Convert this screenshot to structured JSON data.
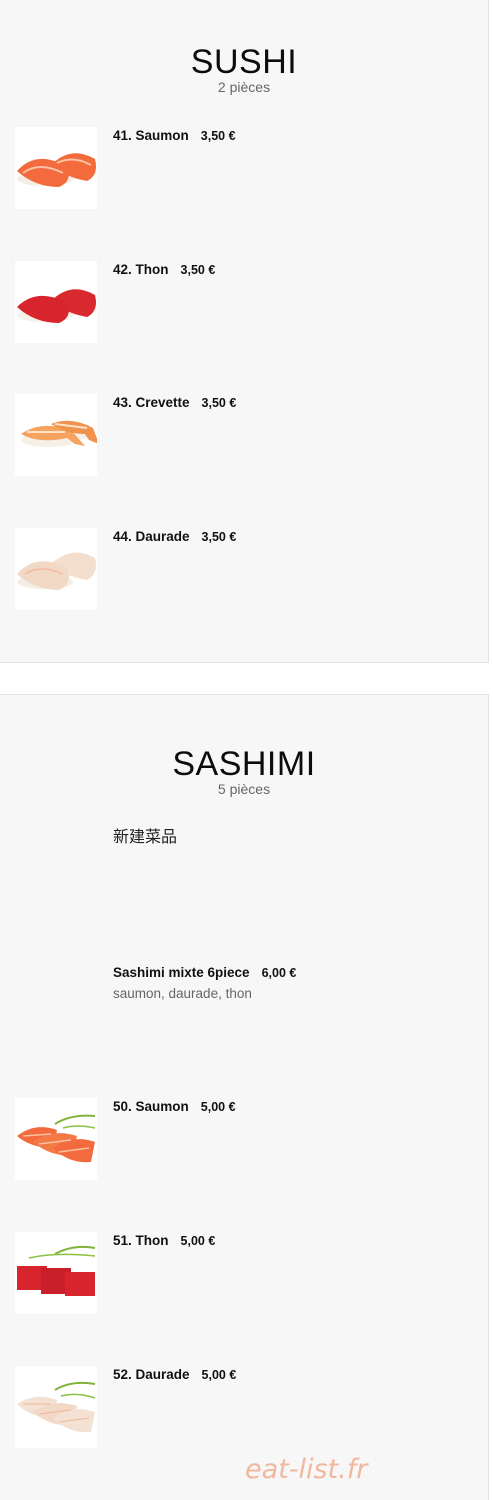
{
  "sushi": {
    "title": "SUSHI",
    "subtitle": "2 pièces",
    "items": [
      {
        "name": "41. Saumon",
        "price": "3,50 €",
        "image": "salmon-nigiri"
      },
      {
        "name": "42. Thon",
        "price": "3,50 €",
        "image": "tuna-nigiri"
      },
      {
        "name": "43. Crevette",
        "price": "3,50 €",
        "image": "shrimp-nigiri"
      },
      {
        "name": "44. Daurade",
        "price": "3,50 €",
        "image": "seabream-nigiri"
      }
    ]
  },
  "sashimi": {
    "title": "SASHIMI",
    "subtitle": "5 pièces",
    "new_dish_label": "新建菜品",
    "items": [
      {
        "name": "Sashimi mixte 6piece",
        "price": "6,00 €",
        "description": "saumon, daurade, thon"
      },
      {
        "name": "50. Saumon",
        "price": "5,00 €",
        "image": "salmon-sashimi"
      },
      {
        "name": "51. Thon",
        "price": "5,00 €",
        "image": "tuna-sashimi"
      },
      {
        "name": "52. Daurade",
        "price": "5,00 €",
        "image": "seabream-sashimi"
      }
    ]
  },
  "watermark": "eat-list.fr",
  "colors": {
    "panel_bg": "#f7f7f7",
    "salmon": "#f26a3d",
    "tuna": "#d8242c",
    "seabream": "#f1d9c6",
    "watermark": "#f2b89f"
  }
}
